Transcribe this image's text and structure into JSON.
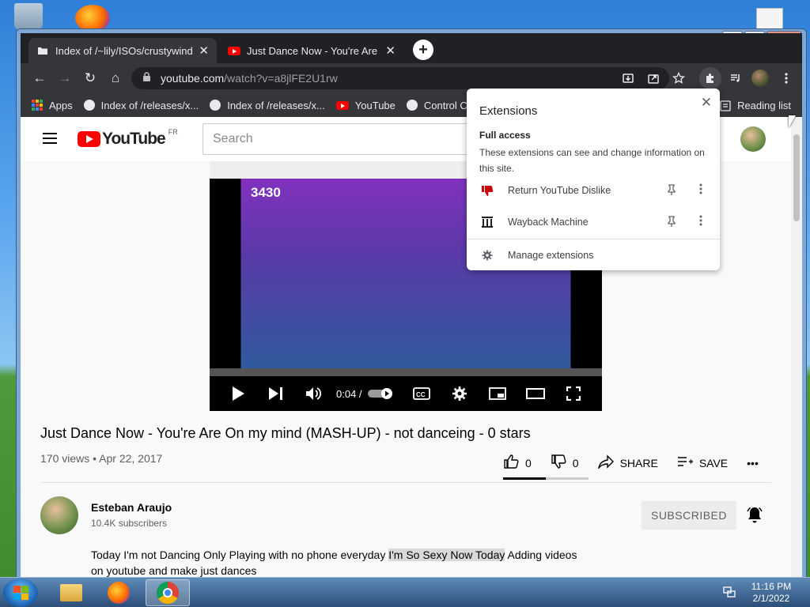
{
  "window": {
    "minimize": "—",
    "maximize": "□",
    "close": "✕"
  },
  "tabs": [
    {
      "title": "Index of /~lily/ISOs/crustywindows",
      "close": "✕"
    },
    {
      "title": "Just Dance Now - You're Are On my mind",
      "close": "✕"
    }
  ],
  "new_tab": "+",
  "toolbar": {
    "back": "←",
    "forward": "→",
    "reload": "↻",
    "home": "⌂",
    "url_host": "youtube.com",
    "url_path": "/watch?v=a8jlFE2U1rw",
    "lock": "🔒"
  },
  "bookmarks": [
    {
      "label": "Apps"
    },
    {
      "label": "Index of /releases/x..."
    },
    {
      "label": "Index of /releases/x..."
    },
    {
      "label": "YouTube"
    },
    {
      "label": "Control Colla"
    }
  ],
  "reading_list": "Reading list",
  "youtube": {
    "logo_text": "YouTube",
    "country": "FR",
    "search_placeholder": "Search",
    "video": {
      "title": "Just Dance Now - You're Are On my mind (MASH-UP) - not danceing - 0 stars",
      "meta": "170 views • Apr 22, 2017",
      "time": "0:04 /",
      "in_video_logo": "3430"
    },
    "actions": {
      "likes": "0",
      "dislikes": "0",
      "share": "SHARE",
      "save": "SAVE",
      "more": "•••"
    },
    "channel": {
      "name": "Esteban Araujo",
      "subscribers": "10.4K subscribers",
      "subscribe_state": "SUBSCRIBED"
    },
    "description": {
      "before": "Today I'm not Dancing Only Playing with no phone everyday ",
      "highlight": "I'm So Sexy Now Today",
      "after": " Adding videos on youtube and make just dances"
    }
  },
  "extensions_popup": {
    "title": "Extensions",
    "close": "✕",
    "full_access_heading": "Full access",
    "full_access_desc": "These extensions can see and change information on this site.",
    "items": [
      {
        "name": "Return YouTube Dislike"
      },
      {
        "name": "Wayback Machine"
      }
    ],
    "manage": "Manage extensions"
  },
  "taskbar": {
    "time": "11:16 PM",
    "date": "2/1/2022"
  },
  "colors": {
    "youtube_red": "#ff0000",
    "chrome_dark": "#202124",
    "chrome_toolbar": "#35363a"
  }
}
